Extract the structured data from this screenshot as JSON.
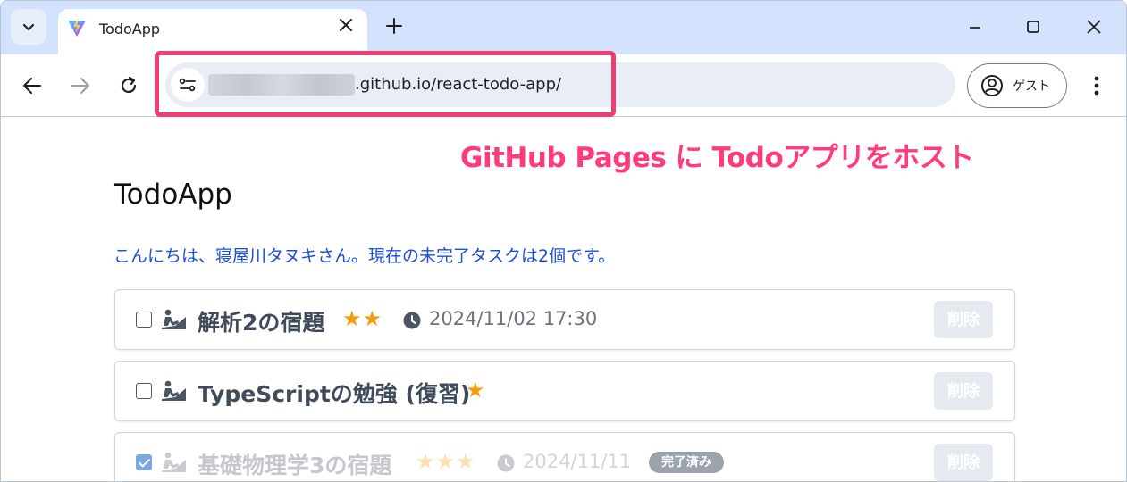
{
  "browser": {
    "tab_title": "TodoApp",
    "new_tab_symbol": "+",
    "url_suffix": ".github.io/react-todo-app/",
    "guest_label": "ゲスト"
  },
  "annotation": {
    "text": "GitHub Pages に Todoアプリをホスト",
    "color": "#ff3b7c"
  },
  "page": {
    "title": "TodoApp",
    "greeting": "こんにちは、寝屋川タヌキさん。現在の未完了タスクは2個です。"
  },
  "todos": [
    {
      "name": "解析2の宿題",
      "stars": "★★",
      "deadline": "2024/11/02 17:30",
      "done": false,
      "delete_label": "削除"
    },
    {
      "name": "TypeScriptの勉強 (復習)",
      "stars": "★",
      "deadline": "",
      "done": false,
      "delete_label": "削除"
    },
    {
      "name": "基礎物理学3の宿題",
      "stars": "★★★",
      "deadline": "2024/11/11",
      "done": true,
      "badge": "完了済み",
      "delete_label": "削除"
    }
  ],
  "colors": {
    "tabstrip": "#d3e3fd",
    "greeting": "#1d4ed8",
    "star": "#f59e0b",
    "highlight_border": "#f03e72"
  },
  "icons": [
    "chevron-down-icon",
    "vite-favicon-icon",
    "close-icon",
    "plus-icon",
    "minimize-icon",
    "maximize-icon",
    "back-icon",
    "forward-icon",
    "reload-icon",
    "site-info-icon",
    "account-icon",
    "more-vert-icon",
    "person-working-icon",
    "clock-icon"
  ]
}
